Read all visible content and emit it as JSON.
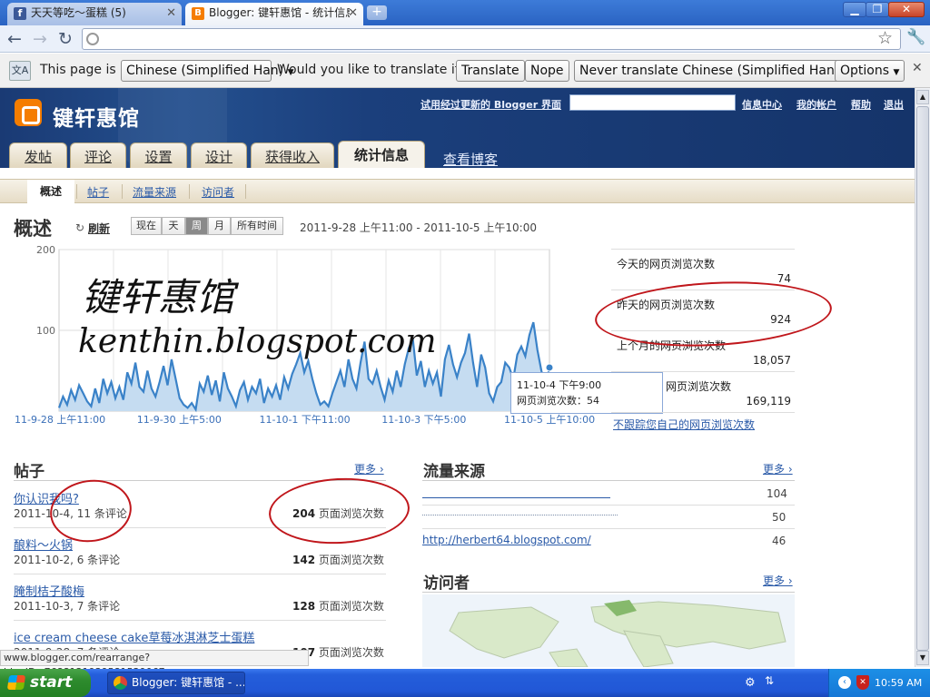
{
  "browser": {
    "tabs": [
      {
        "label": "天天等吃～蛋糕 (5)",
        "icon": "facebook-icon"
      },
      {
        "label": "Blogger: 键轩惠馆 - 统计信息",
        "icon": "blogger-icon"
      }
    ],
    "window_buttons": [
      "minimize",
      "maximize",
      "close"
    ]
  },
  "translate_bar": {
    "prefix": "This page is in",
    "language": "Chinese (Simplified Han)",
    "question": "Would you like to translate it?",
    "translate": "Translate",
    "nope": "Nope",
    "never": "Never translate Chinese (Simplified Han)",
    "options": "Options"
  },
  "blogger": {
    "blog_title": "键轩惠馆",
    "header_links": [
      "试用经过更新的 Blogger 界面",
      "信息中心",
      "我的帐户",
      "帮助",
      "退出"
    ],
    "main_tabs": [
      "发帖",
      "评论",
      "设置",
      "设计",
      "获得收入",
      "统计信息"
    ],
    "view_blog": "查看博客",
    "sub_tabs": [
      "概述",
      "帖子",
      "流量来源",
      "访问者"
    ]
  },
  "overview": {
    "title": "概述",
    "refresh": "刷新",
    "ranges": [
      "现在",
      "天",
      "周",
      "月",
      "所有时间"
    ],
    "active_range": "周",
    "date_range": "2011-9-28 上午11:00 - 2011-10-5 上午10:00"
  },
  "watermark": {
    "line1": "键轩惠馆",
    "line2": "kenthin.blogspot.com"
  },
  "tooltip": {
    "time": "11-10-4 下午9:00",
    "value_label": "网页浏览次数：54"
  },
  "chart_data": {
    "type": "area",
    "y_ticks": [
      "200",
      "100"
    ],
    "ylim": [
      0,
      200
    ],
    "x_tick_labels": [
      "11-9-28 上午11:00",
      "11-9-30 上午5:00",
      "11-10-1 下午11:00",
      "11-10-3 下午5:00",
      "11-10-5 上午10:00"
    ],
    "values": [
      4,
      18,
      8,
      26,
      14,
      32,
      22,
      12,
      6,
      28,
      10,
      40,
      22,
      36,
      16,
      30,
      14,
      48,
      34,
      60,
      30,
      24,
      50,
      28,
      18,
      36,
      56,
      32,
      64,
      40,
      16,
      8,
      4,
      10,
      2,
      34,
      24,
      44,
      20,
      38,
      12,
      48,
      28,
      18,
      6,
      26,
      36,
      14,
      30,
      22,
      40,
      10,
      28,
      18,
      32,
      14,
      42,
      28,
      46,
      58,
      72,
      48,
      62,
      40,
      22,
      8,
      12,
      6,
      22,
      36,
      50,
      30,
      64,
      40,
      28,
      60,
      86,
      40,
      34,
      50,
      30,
      14,
      38,
      24,
      50,
      30,
      58,
      78,
      90,
      44,
      62,
      30,
      50,
      34,
      48,
      18,
      64,
      82,
      58,
      42,
      60,
      72,
      96,
      60,
      30,
      70,
      54,
      22,
      12,
      30,
      36,
      60,
      54,
      40,
      70,
      80,
      68,
      94,
      110,
      76,
      50,
      30,
      54
    ],
    "color": "#3a82c8",
    "fill": "#c5dcf1",
    "highlight": {
      "index": 122,
      "value": 54
    }
  },
  "stats": [
    {
      "label": "今天的网页浏览次数",
      "value": "74"
    },
    {
      "label": "昨天的网页浏览次数",
      "value": "924"
    },
    {
      "label": "上个月的网页浏览次数",
      "value": "18,057"
    },
    {
      "label": "网页浏览次数",
      "value": "169,119"
    }
  ],
  "dont_track": "不跟踪您自己的网页浏览次数",
  "posts": {
    "title": "帖子",
    "more": "更多 ›",
    "items": [
      {
        "title": "你认识我吗?",
        "meta": "2011-10-4, 11 条评论",
        "views": "204",
        "views_label": "页面浏览次数"
      },
      {
        "title": "酿料～火锅",
        "meta": "2011-10-2, 6 条评论",
        "views": "142",
        "views_label": "页面浏览次数"
      },
      {
        "title": "腌制桔子酸梅",
        "meta": "2011-10-3, 7 条评论",
        "views": "128",
        "views_label": "页面浏览次数"
      },
      {
        "title": "ice cream cheese cake草莓冰淇淋芝士蛋糕",
        "meta": "2011-9-28, 7 条评论",
        "views": "107",
        "views_label": "页面浏览次数"
      }
    ]
  },
  "traffic": {
    "title": "流量来源",
    "more": "更多 ›",
    "items": [
      {
        "url": "",
        "count": "104"
      },
      {
        "url": "",
        "count": "50"
      },
      {
        "url": "http://herbert64.blogspot.com/",
        "count": "46"
      }
    ]
  },
  "visitors": {
    "title": "访问者",
    "more": "更多 ›"
  },
  "statusbar": {
    "url": "www.blogger.com/rearrange?blogID=7688121939581529067"
  },
  "taskbar": {
    "start": "start",
    "item": "Blogger: 键轩惠馆 - ...",
    "clock": "10:59 AM"
  }
}
